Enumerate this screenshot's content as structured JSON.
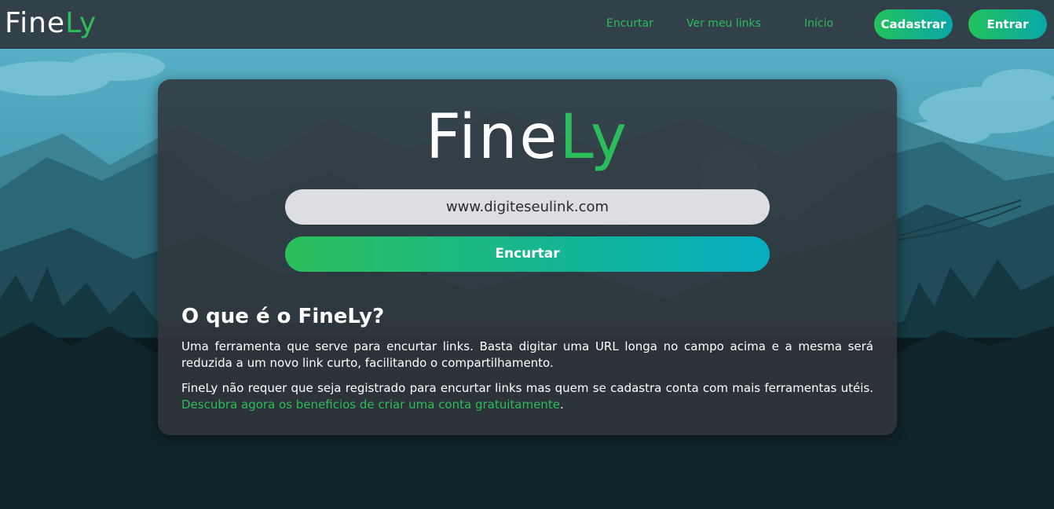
{
  "brand": {
    "name_main": "Fine",
    "name_accent": "Ly"
  },
  "nav": {
    "links": [
      "Encurtar",
      "Ver meu links",
      "Início"
    ],
    "register_label": "Cadastrar",
    "login_label": "Entrar"
  },
  "shortener": {
    "input_value": "www.digiteseulink.com",
    "button_label": "Encurtar"
  },
  "about": {
    "title": "O que é o FineLy?",
    "paragraph1": "Uma ferramenta que serve para encurtar links. Basta digitar uma URL longa no campo acima e a mesma será reduzida a um novo link curto, facilitando o compartilhamento.",
    "paragraph2_text": "FineLy não requer que seja registrado para encurtar links mas quem se cadastra conta com mais ferramentas utéis.",
    "paragraph2_link": "Descubra agora os beneficios de criar uma conta gratuitamente",
    "paragraph2_end": "."
  },
  "colors": {
    "accent": "#2bbd5b",
    "navbar": "#324049",
    "card": "#31353b",
    "gradient_start": "#22c25b",
    "gradient_end": "#0aa7a9"
  }
}
